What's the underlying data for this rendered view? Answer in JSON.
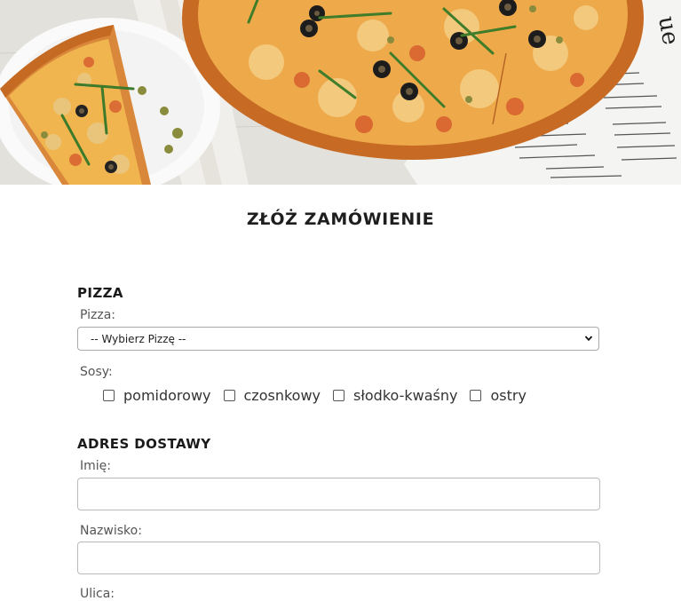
{
  "form": {
    "title": "ZŁÓŻ ZAMÓWIENIE",
    "pizza_section": {
      "heading": "PIZZA",
      "pizza_label": "Pizza:",
      "pizza_select_value": "-- Wybierz Pizzę --",
      "sauces_label": "Sosy:",
      "sauces": [
        {
          "label": "pomidorowy",
          "checked": false
        },
        {
          "label": "czosnkowy",
          "checked": false
        },
        {
          "label": "słodko-kwaśny",
          "checked": false
        },
        {
          "label": "ostry",
          "checked": false
        }
      ]
    },
    "address_section": {
      "heading": "ADRES DOSTAWY",
      "first_name_label": "Imię:",
      "first_name_value": "",
      "last_name_label": "Nazwisko:",
      "last_name_value": "",
      "street_label": "Ulica:"
    }
  },
  "icons": {
    "select_arrow": "chevron-down-icon",
    "checkbox": "checkbox-unchecked-icon"
  }
}
